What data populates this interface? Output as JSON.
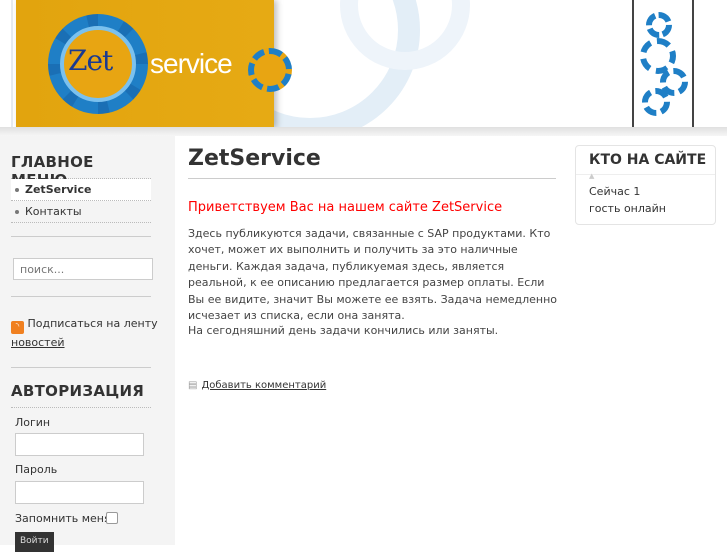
{
  "header": {
    "logo_text_1": "Zet",
    "logo_text_2": "service"
  },
  "sidebar": {
    "main_menu_title": "ГЛАВНОЕ МЕНЮ",
    "menu_items": [
      {
        "label": "ZetService",
        "active": true
      },
      {
        "label": "Контакты",
        "active": false
      }
    ],
    "search_placeholder": "поиск...",
    "rss_text": "Подписаться на ленту",
    "rss_link": "новостей",
    "auth_title": "АВТОРИЗАЦИЯ",
    "login_label": "Логин",
    "login_value": "",
    "password_label": "Пароль",
    "password_value": "",
    "remember_label": "Запомнить меня",
    "login_button": "Войти"
  },
  "main": {
    "title": "ZetService",
    "welcome": "Приветствуем Вас на нашем сайте ZetService",
    "paragraph1": "Здесь публикуются задачи, связанные с SAP продуктами. Кто хочет, может их выполнить и получить за это наличные деньги. Каждая задача, публикуемая здесь, является реальной, к ее описанию предлагается размер оплаты. Если Вы ее видите, значит Вы можете ее взять. Задача немедленно исчезает из списка, если она занята.",
    "paragraph2": "На сегодняшний день задачи кончились или заняты.",
    "add_comment": "Добавить комментарий"
  },
  "who_online": {
    "title": "КТО НА САЙТЕ",
    "line1": "Сейчас 1",
    "line2": "гость онлайн"
  },
  "colors": {
    "accent": "#e2a40e",
    "welcome": "#ff0000",
    "gear": "#1f7fc6"
  }
}
